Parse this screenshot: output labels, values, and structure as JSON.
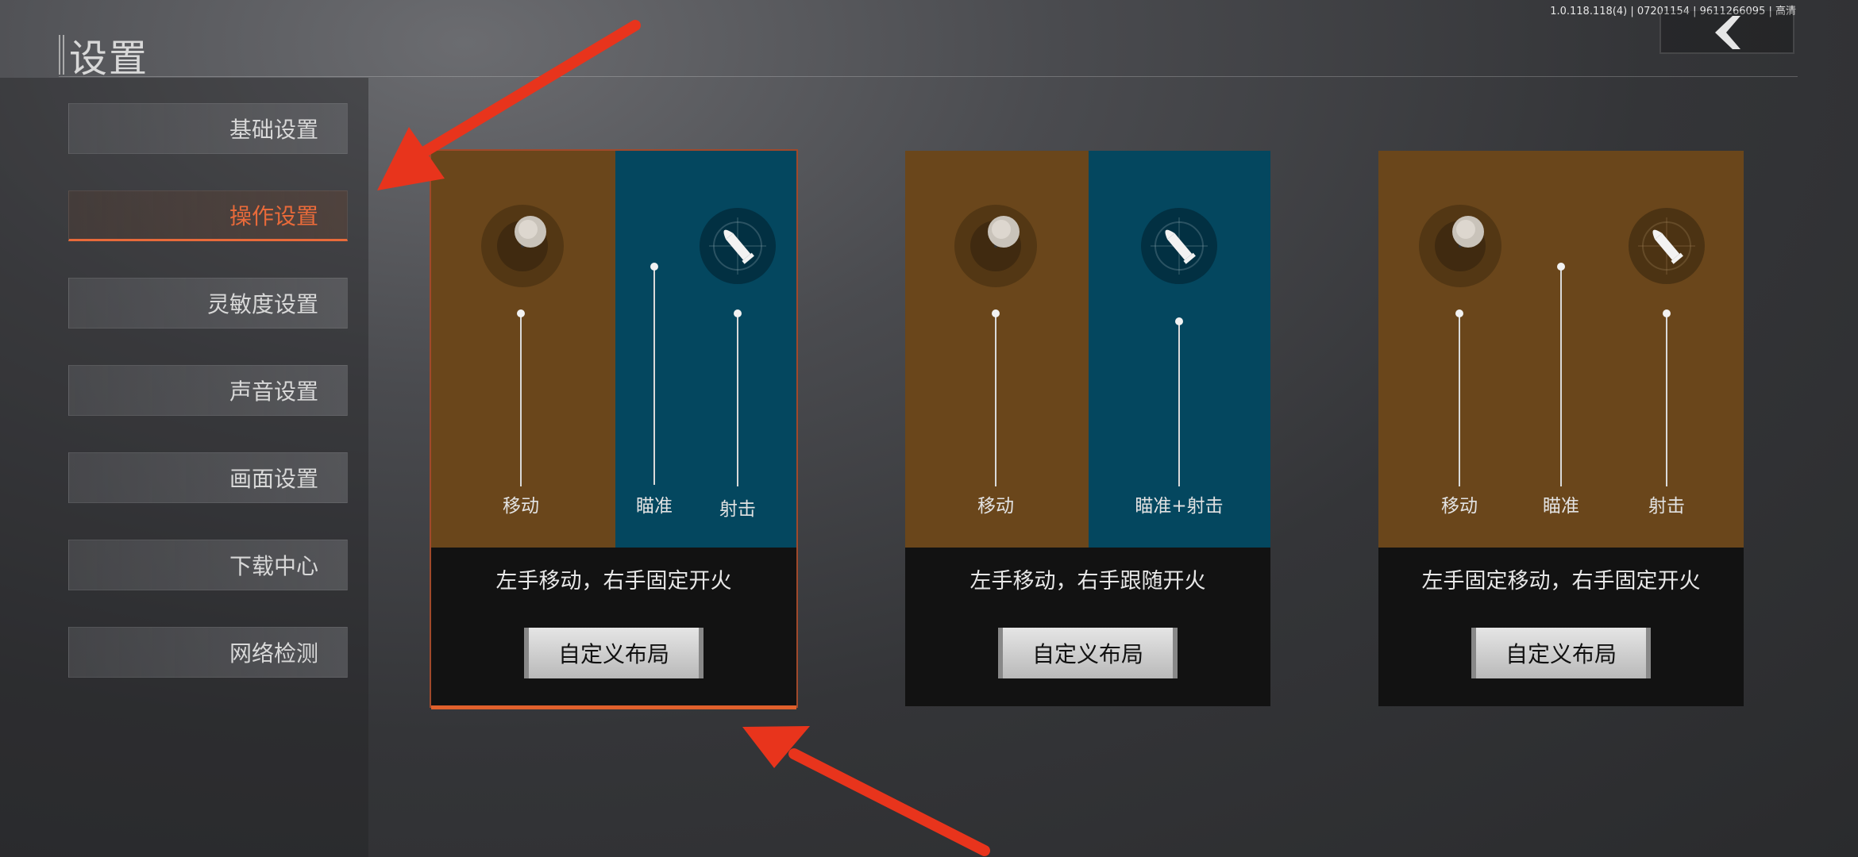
{
  "version": "1.0.118.118(4) | 07201154 | 9611266095 | 高清",
  "title": "设置",
  "sidebar": {
    "items": [
      {
        "label": "基础设置"
      },
      {
        "label": "操作设置"
      },
      {
        "label": "灵敏度设置"
      },
      {
        "label": "声音设置"
      },
      {
        "label": "画面设置"
      },
      {
        "label": "下载中心"
      },
      {
        "label": "网络检测"
      }
    ],
    "active_index": 1
  },
  "cards": [
    {
      "labels": {
        "move": "移动",
        "aim": "瞄准",
        "fire": "射击"
      },
      "desc": "左手移动，右手固定开火",
      "button": "自定义布局",
      "selected": true
    },
    {
      "labels": {
        "move": "移动",
        "aimfire": "瞄准+射击"
      },
      "desc": "左手移动，右手跟随开火",
      "button": "自定义布局",
      "selected": false
    },
    {
      "labels": {
        "move": "移动",
        "aim": "瞄准",
        "fire": "射击"
      },
      "desc": "左手固定移动，右手固定开火",
      "button": "自定义布局",
      "selected": false
    }
  ],
  "icons": {
    "back": "chevron-left-icon",
    "joystick": "joystick-icon",
    "fire": "bullet-crosshair-icon"
  },
  "colors": {
    "accent": "#e86a3a",
    "brown_panel": "#6a461b",
    "teal_panel": "#04475f",
    "annotation_arrow": "#e8341c"
  }
}
